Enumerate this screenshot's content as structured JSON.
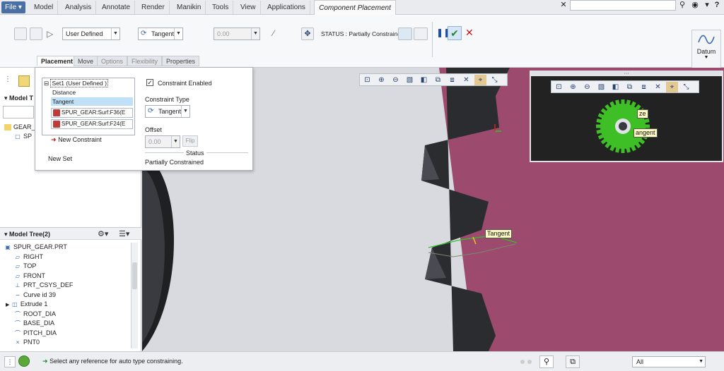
{
  "menu": {
    "file": "File",
    "tabs": [
      "Model",
      "Analysis",
      "Annotate",
      "Render",
      "Manikin",
      "Tools",
      "View",
      "Applications"
    ],
    "active_tab": "Component Placement"
  },
  "ribbon": {
    "constraint_set_type": "User Defined",
    "constraint_type": "Tangent",
    "offset_value": "0.00",
    "status": "STATUS : Partially Constrained",
    "datum_label": "Datum"
  },
  "subtabs": [
    "Placement",
    "Move",
    "Options",
    "Flexibility",
    "Properties"
  ],
  "placement_panel": {
    "set_label": "Set1 (User Defined )",
    "constraints": [
      "Distance",
      "Tangent"
    ],
    "refs": [
      "SPUR_GEAR:Surf:F36(E",
      "SPUR_GEAR:Surf:F24(E"
    ],
    "new_constraint": "New Constraint",
    "new_set": "New Set",
    "constraint_enabled": "Constraint Enabled",
    "constraint_type_label": "Constraint Type",
    "constraint_type_value": "Tangent",
    "offset_label": "Offset",
    "offset_value": "0.00",
    "flip": "Flip",
    "status_label": "Status",
    "status_value": "Partially Constrained"
  },
  "model_tree_top": {
    "title": "Model T",
    "items": [
      "GEAR_",
      "SP"
    ]
  },
  "model_tree2": {
    "title": "Model Tree(2)",
    "items": [
      "SPUR_GEAR.PRT",
      "RIGHT",
      "TOP",
      "FRONT",
      "PRT_CSYS_DEF",
      "Curve id 39",
      "Extrude 1",
      "ROOT_DIA",
      "BASE_DIA",
      "PITCH_DIA",
      "PNT0"
    ]
  },
  "viewport": {
    "tag_main": "Tangent",
    "tag_inset_1": "ze",
    "tag_inset_2": "angent"
  },
  "statusbar": {
    "message": "Select any reference for auto type constraining.",
    "filter": "All"
  },
  "colors": {
    "magenta_bg": "#9c4a6d",
    "gear_green": "#3fbf26",
    "gear_dark": "#2b2c30"
  }
}
